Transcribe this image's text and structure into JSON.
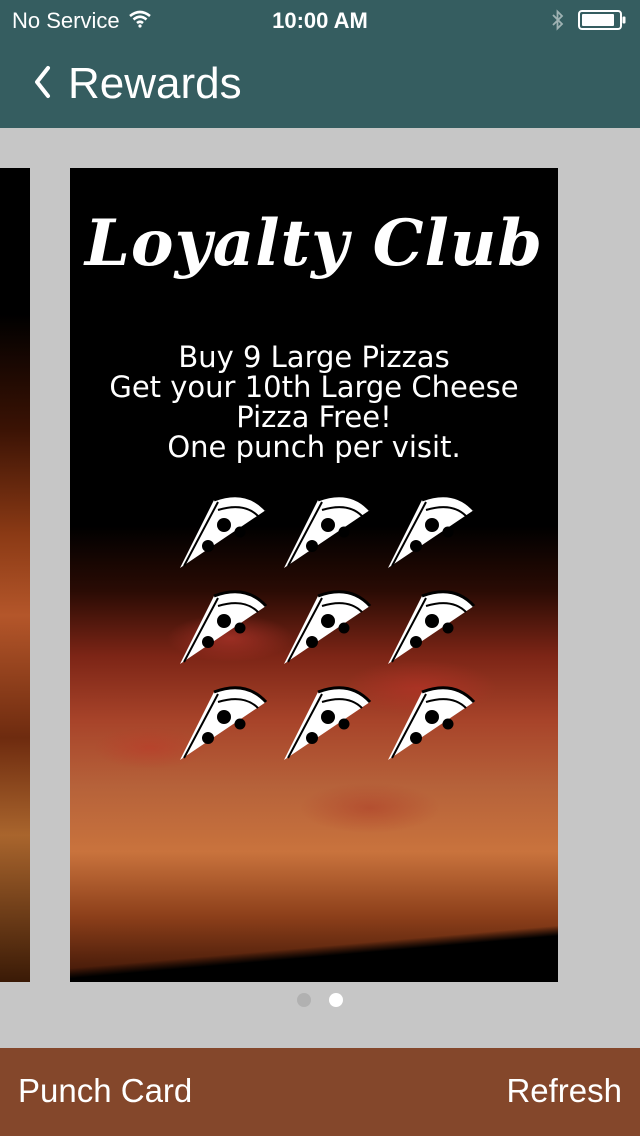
{
  "status_bar": {
    "carrier": "No Service",
    "time": "10:00 AM",
    "wifi_icon": "wifi-icon",
    "bluetooth_icon": "bluetooth-icon",
    "battery_icon": "battery-icon"
  },
  "nav": {
    "back_icon": "chevron-left-icon",
    "title": "Rewards"
  },
  "card": {
    "title": "Loyalty Club",
    "offer_lines": [
      "Buy 9 Large Pizzas",
      "Get your 10th Large Cheese",
      "Pizza Free!",
      "One punch per visit."
    ],
    "punch_icon": "pizza-slice-icon",
    "punch_count_total": 9
  },
  "pager": {
    "pages": 2,
    "current_page": 2
  },
  "toolbar": {
    "punch_card_label": "Punch Card",
    "refresh_label": "Refresh"
  },
  "colors": {
    "header_bg": "#355d60",
    "toolbar_bg": "#84472b",
    "page_bg": "#c6c6c6"
  }
}
